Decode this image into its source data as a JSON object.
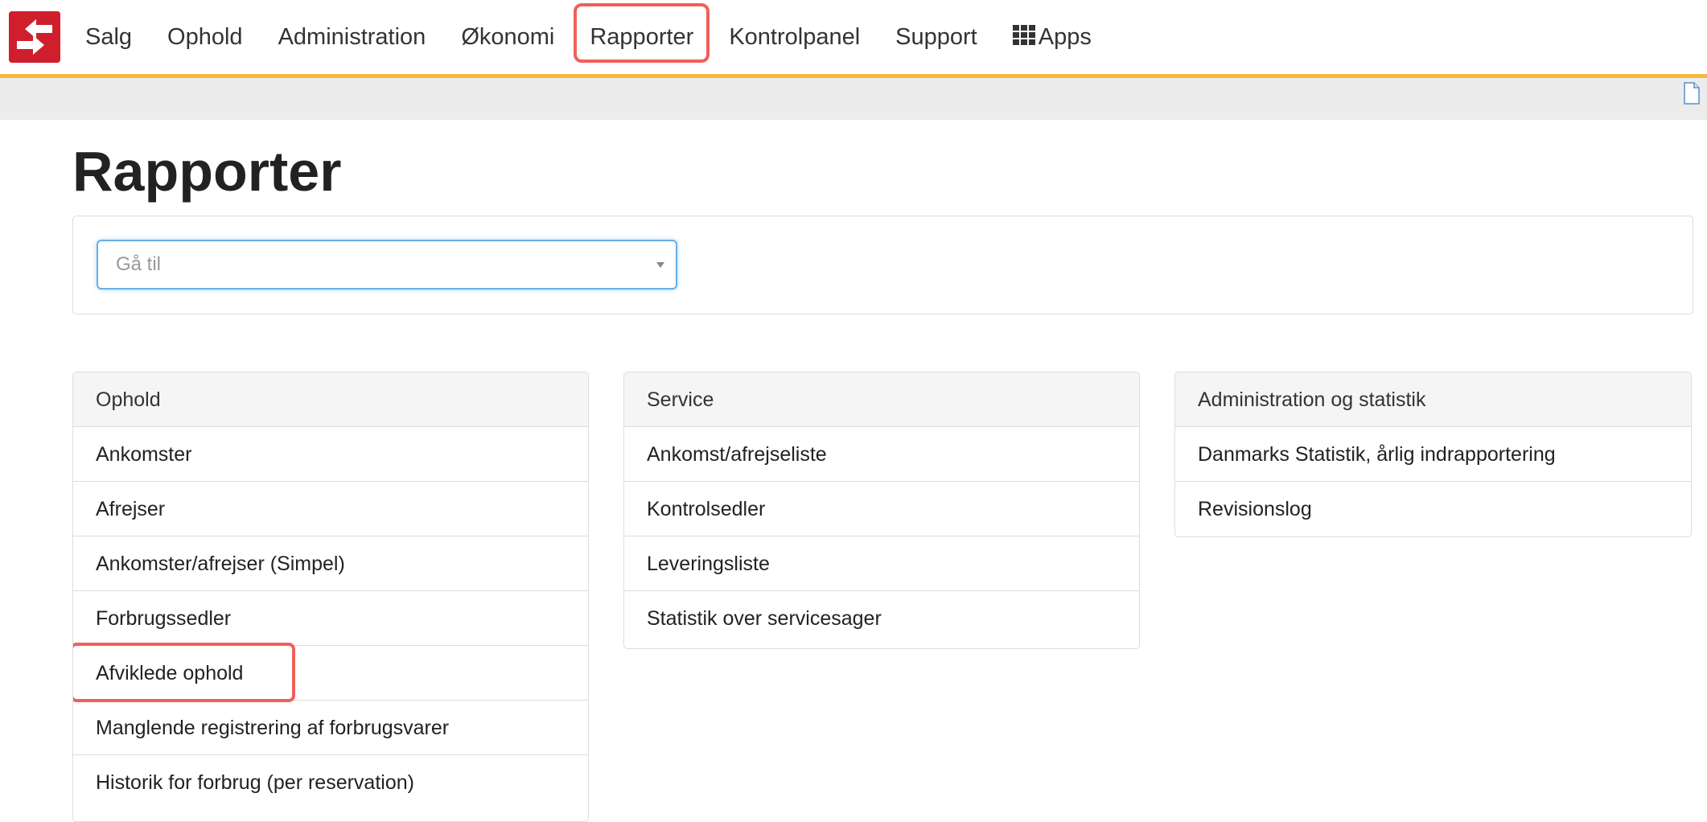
{
  "nav": {
    "items": [
      {
        "label": "Salg"
      },
      {
        "label": "Ophold"
      },
      {
        "label": "Administration"
      },
      {
        "label": "Økonomi"
      },
      {
        "label": "Rapporter",
        "highlighted": true
      },
      {
        "label": "Kontrolpanel"
      },
      {
        "label": "Support"
      },
      {
        "label": "Apps",
        "icon": "apps-grid-icon"
      }
    ]
  },
  "page": {
    "title": "Rapporter"
  },
  "goto": {
    "placeholder": "Gå til"
  },
  "panels": [
    {
      "heading": "Ophold",
      "items": [
        "Ankomster",
        "Afrejser",
        "Ankomster/afrejser (Simpel)",
        "Forbrugssedler",
        "Afviklede ophold",
        "Manglende registrering af forbrugsvarer",
        "Historik for forbrug (per reservation)"
      ]
    },
    {
      "heading": "Service",
      "items": [
        "Ankomst/afrejseliste",
        "Kontrolsedler",
        "Leveringsliste",
        "Statistik over servicesager"
      ]
    },
    {
      "heading": "Administration og statistik",
      "items": [
        "Danmarks Statistik, årlig indrapportering",
        "Revisionslog"
      ]
    }
  ],
  "colors": {
    "brand": "#cf1f2d",
    "nav_underline": "#f5b83d",
    "highlight_ring": "#f0605a",
    "focus_border": "#66afe9"
  }
}
